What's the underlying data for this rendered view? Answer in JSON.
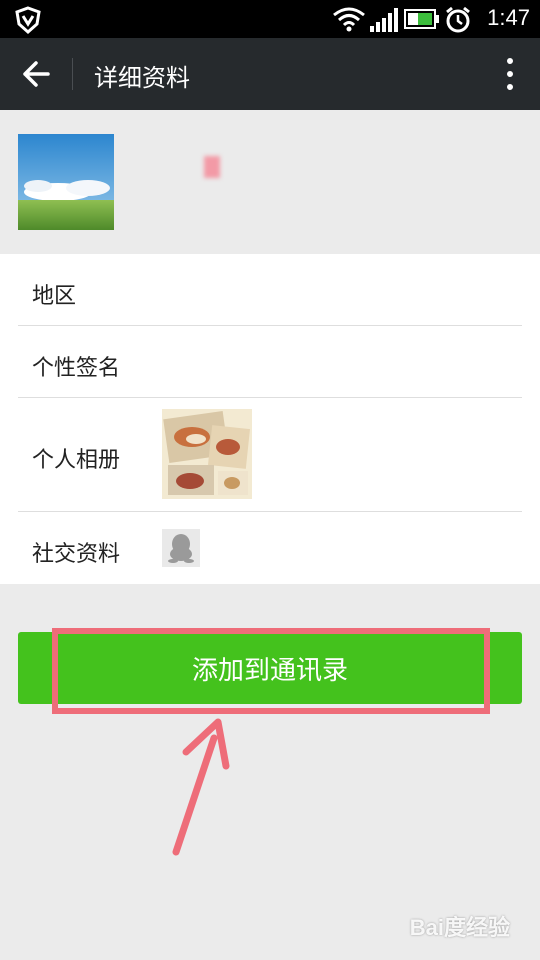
{
  "status_bar": {
    "time": "1:47"
  },
  "title_bar": {
    "title": "详细资料"
  },
  "profile": {
    "nickname": "",
    "wechat_id": ""
  },
  "info": {
    "region": {
      "label": "地区",
      "value": ""
    },
    "signature": {
      "label": "个性签名",
      "value": ""
    },
    "album": {
      "label": "个人相册"
    },
    "social": {
      "label": "社交资料"
    }
  },
  "actions": {
    "add_contact_label": "添加到通讯录"
  },
  "watermark": "Bai度经验",
  "colors": {
    "accent_green": "#44c21d",
    "titlebar": "#262a2d",
    "highlight": "#ee6d79"
  }
}
